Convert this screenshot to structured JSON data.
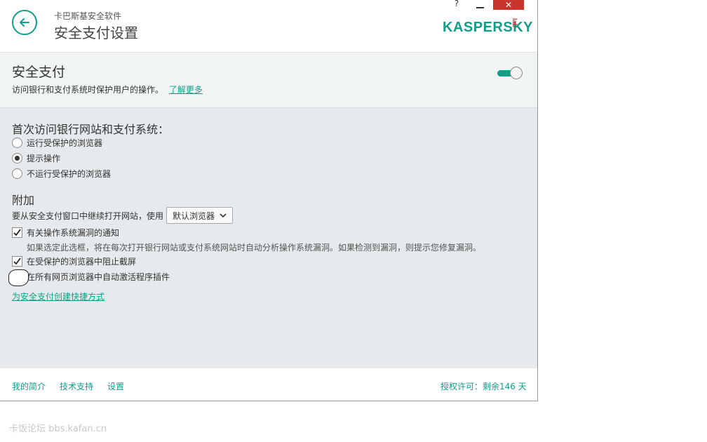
{
  "header": {
    "suite_name": "卡巴斯基安全软件",
    "page_title": "安全支付设置",
    "help_label": "?",
    "close_label": "✕",
    "logo": "KASPERSKY",
    "logo_lab": "lab"
  },
  "feature": {
    "title": "安全支付",
    "description": "访问银行和支付系统时保护用户的操作。",
    "learn_more": "了解更多",
    "enabled": true
  },
  "settings": {
    "first_visit_heading": "首次访问银行网站和支付系统：",
    "radio_options": [
      {
        "label": "运行受保护的浏览器",
        "selected": false
      },
      {
        "label": "提示操作",
        "selected": true
      },
      {
        "label": "不运行受保护的浏览器",
        "selected": false
      }
    ],
    "additional_heading": "附加",
    "open_sites_label": "要从安全支付窗口中继续打开网站，使用",
    "browser_select": "默认浏览器",
    "checkboxes": [
      {
        "label": "有关操作系统漏洞的通知",
        "checked": true
      },
      {
        "label": "在受保护的浏览器中阻止截屏",
        "checked": true
      },
      {
        "label": "在所有网页浏览器中自动激活程序插件",
        "checked": false
      }
    ],
    "vuln_hint": "如果选定此选框，将在每次打开银行网站或支付系统网站时自动分析操作系统漏洞。如果检测到漏洞，则提示您修复漏洞。",
    "create_shortcut": "为安全支付创建快捷方式"
  },
  "footer": {
    "links": [
      "我的简介",
      "技术支持",
      "设置"
    ],
    "license": "授权许可：剩余146 天"
  },
  "watermark": "卡饭论坛 bbs.kafan.cn",
  "colors": {
    "accent": "#119e88",
    "close": "#c8352c"
  }
}
